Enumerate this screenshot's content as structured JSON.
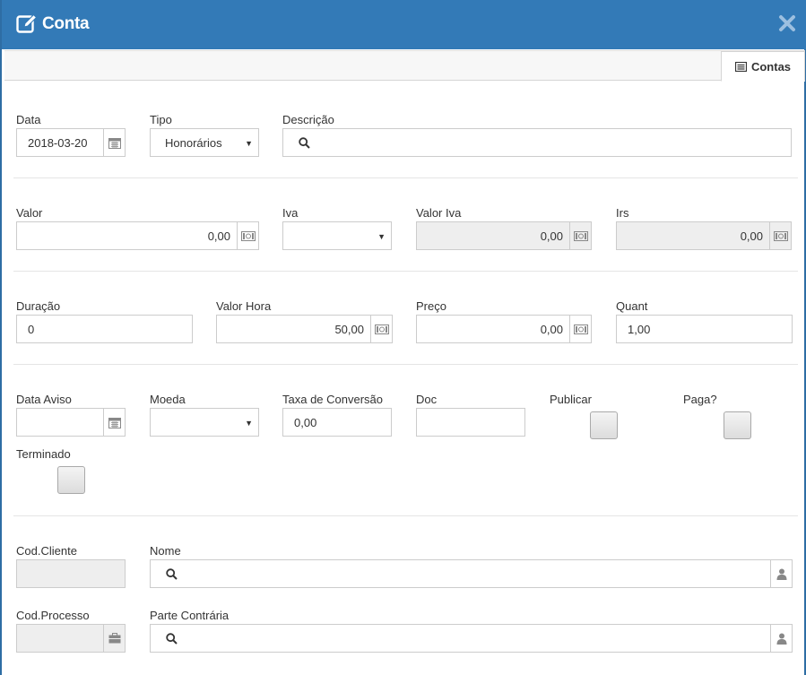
{
  "header": {
    "title": "Conta"
  },
  "tabs": [
    {
      "label": "Contas"
    }
  ],
  "row1": {
    "data": {
      "label": "Data",
      "value": "2018-03-20"
    },
    "tipo": {
      "label": "Tipo",
      "value": "Honorários"
    },
    "descricao": {
      "label": "Descrição",
      "value": ""
    }
  },
  "row2": {
    "valor": {
      "label": "Valor",
      "value": "0,00"
    },
    "iva": {
      "label": "Iva",
      "value": ""
    },
    "valor_iva": {
      "label": "Valor Iva",
      "value": "0,00"
    },
    "irs": {
      "label": "Irs",
      "value": "0,00"
    }
  },
  "row3": {
    "duracao": {
      "label": "Duração",
      "value": "0"
    },
    "valor_hora": {
      "label": "Valor Hora",
      "value": "50,00"
    },
    "preco": {
      "label": "Preço",
      "value": "0,00"
    },
    "quant": {
      "label": "Quant",
      "value": "1,00"
    }
  },
  "row4": {
    "data_aviso": {
      "label": "Data Aviso",
      "value": ""
    },
    "moeda": {
      "label": "Moeda",
      "value": ""
    },
    "taxa": {
      "label": "Taxa de Conversão",
      "value": "0,00"
    },
    "doc": {
      "label": "Doc",
      "value": ""
    },
    "publicar": {
      "label": "Publicar"
    },
    "paga": {
      "label": "Paga?"
    },
    "terminado": {
      "label": "Terminado"
    }
  },
  "row5": {
    "cod_cliente": {
      "label": "Cod.Cliente",
      "value": ""
    },
    "nome": {
      "label": "Nome",
      "value": ""
    },
    "cod_processo": {
      "label": "Cod.Processo",
      "value": ""
    },
    "parte_contraria": {
      "label": "Parte Contrária",
      "value": ""
    }
  },
  "colors": {
    "header": "#337ab7",
    "readonly": "#eeeeee",
    "border": "#cccccc"
  },
  "icons": {
    "title": "edit-icon",
    "close": "close-icon",
    "tab": "list-icon",
    "calendar": "calendar-icon",
    "money": "money-icon",
    "search": "search-icon",
    "user": "user-icon",
    "briefcase": "briefcase-icon",
    "caret": "caret-down-icon"
  }
}
